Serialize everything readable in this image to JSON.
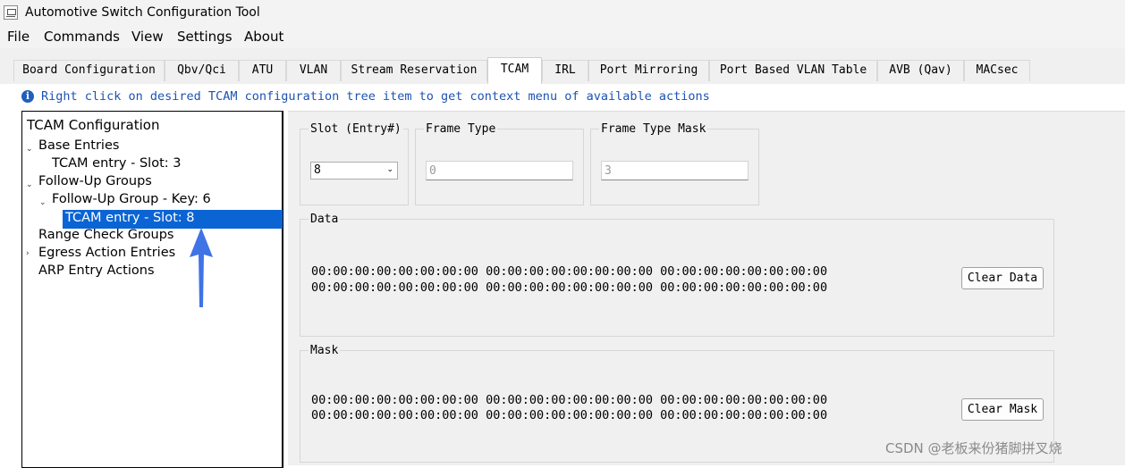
{
  "window": {
    "title": "Automotive Switch Configuration Tool"
  },
  "menu": [
    "File",
    "Commands",
    "View",
    "Settings",
    "About"
  ],
  "tabs": [
    "Board Configuration",
    "Qbv/Qci",
    "ATU",
    "VLAN",
    "Stream Reservation",
    "TCAM",
    "IRL",
    "Port Mirroring",
    "Port Based VLAN Table",
    "AVB (Qav)",
    "MACsec"
  ],
  "active_tab": "TCAM",
  "info": {
    "text": "Right click on desired TCAM configuration tree item to get context menu of available actions",
    "icon": "info-icon"
  },
  "tree": {
    "root": "TCAM Configuration",
    "base_entries": {
      "label": "Base Entries",
      "child": "TCAM entry - Slot: 3"
    },
    "follow_up_groups": {
      "label": "Follow-Up Groups",
      "group": "Follow-Up Group - Key: 6",
      "selected": "TCAM entry - Slot: 8"
    },
    "range_check": "Range Check Groups",
    "egress_action": "Egress Action Entries",
    "arp_entry": "ARP Entry Actions"
  },
  "slot": {
    "label": "Slot (Entry#)",
    "value": "8"
  },
  "frame_type": {
    "label": "Frame Type",
    "value": "0"
  },
  "frame_type_mask": {
    "label": "Frame Type Mask",
    "value": "3"
  },
  "data": {
    "label": "Data",
    "line1": "00:00:00:00:00:00:00:00 00:00:00:00:00:00:00:00 00:00:00:00:00:00:00:00",
    "line2": "00:00:00:00:00:00:00:00 00:00:00:00:00:00:00:00 00:00:00:00:00:00:00:00",
    "button": "Clear Data"
  },
  "mask": {
    "label": "Mask",
    "line1": "00:00:00:00:00:00:00:00 00:00:00:00:00:00:00:00 00:00:00:00:00:00:00:00",
    "line2": "00:00:00:00:00:00:00:00 00:00:00:00:00:00:00:00 00:00:00:00:00:00:00:00",
    "button": "Clear Mask"
  },
  "watermark": "CSDN @老板来份猪脚拼叉烧",
  "colors": {
    "accent": "#0a64d4",
    "info_text": "#1c53b3",
    "annotation_arrow": "#3f73e6"
  }
}
